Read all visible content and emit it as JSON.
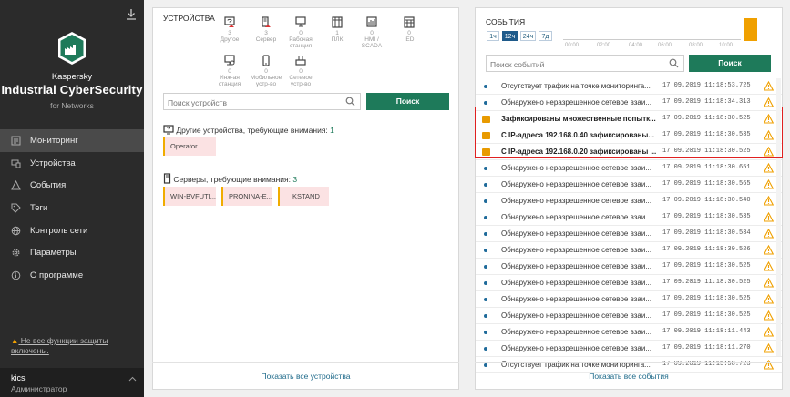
{
  "sidebar": {
    "brand_small": "Kaspersky",
    "brand_big": "Industrial CyberSecurity",
    "brand_sub": "for Networks",
    "items": [
      {
        "label": "Мониторинг",
        "icon": "monitor-icon",
        "active": true
      },
      {
        "label": "Устройства",
        "icon": "devices-icon",
        "active": false
      },
      {
        "label": "События",
        "icon": "warning-icon",
        "active": false
      },
      {
        "label": "Теги",
        "icon": "tag-icon",
        "active": false
      },
      {
        "label": "Контроль сети",
        "icon": "globe-icon",
        "active": false
      },
      {
        "label": "Параметры",
        "icon": "gear-icon",
        "active": false
      },
      {
        "label": "О программе",
        "icon": "info-icon",
        "active": false
      }
    ],
    "warning_text": "Не все функции защиты включены.",
    "user_name": "kics",
    "user_role": "Администратор"
  },
  "devices": {
    "title": "УСТРОЙСТВА",
    "types": [
      {
        "count": "3",
        "label": "Другое",
        "icon": "other-device-icon",
        "alert": true
      },
      {
        "count": "3",
        "label": "Сервер",
        "icon": "server-icon",
        "alert": true
      },
      {
        "count": "0",
        "label": "Рабочая станция",
        "icon": "workstation-icon",
        "alert": false
      },
      {
        "count": "1",
        "label": "ПЛК",
        "icon": "plc-icon",
        "alert": false
      },
      {
        "count": "0",
        "label": "HMI / SCADA",
        "icon": "hmi-icon",
        "alert": false
      },
      {
        "count": "0",
        "label": "IED",
        "icon": "ied-icon",
        "alert": false
      },
      {
        "count": "0",
        "label": "Инж-ая станция",
        "icon": "engineering-station-icon",
        "alert": false
      },
      {
        "count": "0",
        "label": "Мобильное устр-во",
        "icon": "mobile-icon",
        "alert": false
      },
      {
        "count": "0",
        "label": "Сетевое устр-во",
        "icon": "network-device-icon",
        "alert": false
      }
    ],
    "search_placeholder": "Поиск устройств",
    "search_button": "Поиск",
    "other_label": "Другие устройства, требующие внимания: ",
    "other_count": "1",
    "other_chips": [
      "Operator"
    ],
    "servers_label": "Серверы, требующие внимания: ",
    "servers_count": "3",
    "server_chips": [
      "WIN-BVFUTI...",
      "PRONINA-E...",
      "KSTAND"
    ],
    "show_all": "Показать все устройства"
  },
  "events": {
    "title": "СОБЫТИЯ",
    "periods": [
      {
        "label": "1ч",
        "active": false
      },
      {
        "label": "12ч",
        "active": true
      },
      {
        "label": "24ч",
        "active": false
      },
      {
        "label": "7д",
        "active": false
      }
    ],
    "ticks": [
      "00:00",
      "02:00",
      "04:00",
      "06:00",
      "08:00",
      "10:00"
    ],
    "timeline_level": 1.0,
    "search_placeholder": "Поиск событий",
    "search_button": "Поиск",
    "rows": [
      {
        "kind": "dot",
        "bold": false,
        "text": "Отсутствует трафик на точке мониторинга...",
        "time": "17.09.2019 11:18:53.725"
      },
      {
        "kind": "dot",
        "bold": false,
        "text": "Обнаружено неразрешенное сетевое взаи...",
        "time": "17.09.2019 11:18:34.313"
      },
      {
        "kind": "folder",
        "bold": true,
        "text": "Зафиксированы множественные попытк...",
        "time": "17.09.2019 11:18:30.525"
      },
      {
        "kind": "folder",
        "bold": true,
        "text": "С IP-адреса 192.168.0.40 зафиксированы...",
        "time": "17.09.2019 11:18:30.535"
      },
      {
        "kind": "folder",
        "bold": true,
        "text": "С IP-адреса 192.168.0.20 зафиксированы ...",
        "time": "17.09.2019 11:18:30.525"
      },
      {
        "kind": "dot",
        "bold": false,
        "text": "Обнаружено неразрешенное сетевое взаи...",
        "time": "17.09.2019 11:18:30.651"
      },
      {
        "kind": "dot",
        "bold": false,
        "text": "Обнаружено неразрешенное сетевое взаи...",
        "time": "17.09.2019 11:18:30.565"
      },
      {
        "kind": "dot",
        "bold": false,
        "text": "Обнаружено неразрешенное сетевое взаи...",
        "time": "17.09.2019 11:18:30.540"
      },
      {
        "kind": "dot",
        "bold": false,
        "text": "Обнаружено неразрешенное сетевое взаи...",
        "time": "17.09.2019 11:18:30.535"
      },
      {
        "kind": "dot",
        "bold": false,
        "text": "Обнаружено неразрешенное сетевое взаи...",
        "time": "17.09.2019 11:18:30.534"
      },
      {
        "kind": "dot",
        "bold": false,
        "text": "Обнаружено неразрешенное сетевое взаи...",
        "time": "17.09.2019 11:18:30.526"
      },
      {
        "kind": "dot",
        "bold": false,
        "text": "Обнаружено неразрешенное сетевое взаи...",
        "time": "17.09.2019 11:18:30.525"
      },
      {
        "kind": "dot",
        "bold": false,
        "text": "Обнаружено неразрешенное сетевое взаи...",
        "time": "17.09.2019 11:18:30.525"
      },
      {
        "kind": "dot",
        "bold": false,
        "text": "Обнаружено неразрешенное сетевое взаи...",
        "time": "17.09.2019 11:18:30.525"
      },
      {
        "kind": "dot",
        "bold": false,
        "text": "Обнаружено неразрешенное сетевое взаи...",
        "time": "17.09.2019 11:18:30.525"
      },
      {
        "kind": "dot",
        "bold": false,
        "text": "Обнаружено неразрешенное сетевое взаи...",
        "time": "17.09.2019 11:18:11.443"
      },
      {
        "kind": "dot",
        "bold": false,
        "text": "Обнаружено неразрешенное сетевое взаи...",
        "time": "17.09.2019 11:18:11.270"
      },
      {
        "kind": "dot",
        "bold": false,
        "text": "Отсутствует трафик на точке мониторинга...",
        "time": "17.09.2019 11:15:58.723"
      }
    ],
    "show_all": "Показать все события"
  },
  "colors": {
    "accent_green": "#1e7a5a",
    "warning_orange": "#f0a000",
    "highlight_red": "#e02020"
  }
}
